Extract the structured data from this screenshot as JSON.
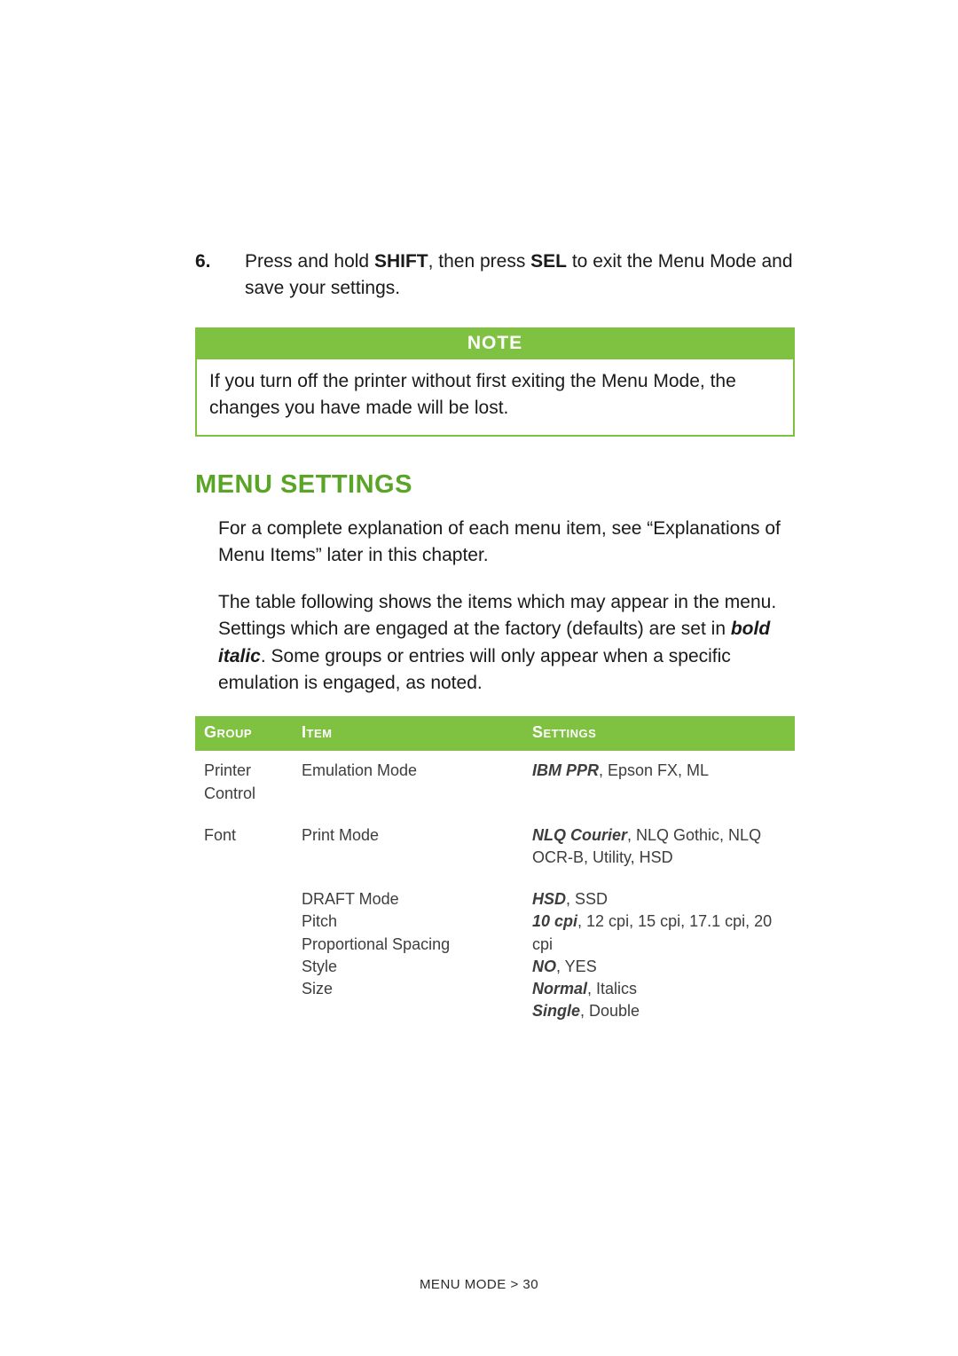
{
  "step": {
    "number": "6.",
    "text_before_shift": "Press and hold ",
    "shift": "SHIFT",
    "text_between": ", then press ",
    "sel": "SEL",
    "text_after": " to exit the Menu Mode and save your settings."
  },
  "note": {
    "title": "NOTE",
    "body": "If you turn off the printer without first exiting the Menu Mode, the changes you have made will be lost."
  },
  "section_title": "MENU SETTINGS",
  "paragraph1": "For a complete explanation of each menu item, see “Explanations of Menu Items” later in this chapter.",
  "paragraph2": {
    "before": "The table following shows the items which may appear in the menu. Settings which are engaged at the factory (defaults) are set in ",
    "bi": "bold italic",
    "after": ". Some groups or entries will only appear when a specific emulation is engaged, as noted."
  },
  "table": {
    "headers": {
      "group": "Group",
      "item": "Item",
      "settings": "Settings"
    },
    "rows": [
      {
        "group": "Printer Control",
        "item": "Emulation Mode",
        "settings": {
          "default": "IBM PPR",
          "rest": ", Epson FX, ML"
        }
      },
      {
        "group": "Font",
        "item": "Print Mode",
        "settings": {
          "default": "NLQ Courier",
          "rest": ", NLQ Gothic, NLQ OCR-B, Utility, HSD"
        }
      },
      {
        "group": "",
        "item_lines": [
          "DRAFT Mode",
          "Pitch",
          "Proportional Spacing",
          "Style",
          "Size"
        ],
        "settings_lines": [
          {
            "default": "HSD",
            "rest": ", SSD"
          },
          {
            "default": "10 cpi",
            "rest": ", 12 cpi, 15 cpi, 17.1 cpi, 20 cpi"
          },
          {
            "default": "NO",
            "rest": ", YES"
          },
          {
            "default": "Normal",
            "rest": ", Italics"
          },
          {
            "default": "Single",
            "rest": ", Double"
          }
        ]
      }
    ]
  },
  "footer": "MENU MODE > 30"
}
